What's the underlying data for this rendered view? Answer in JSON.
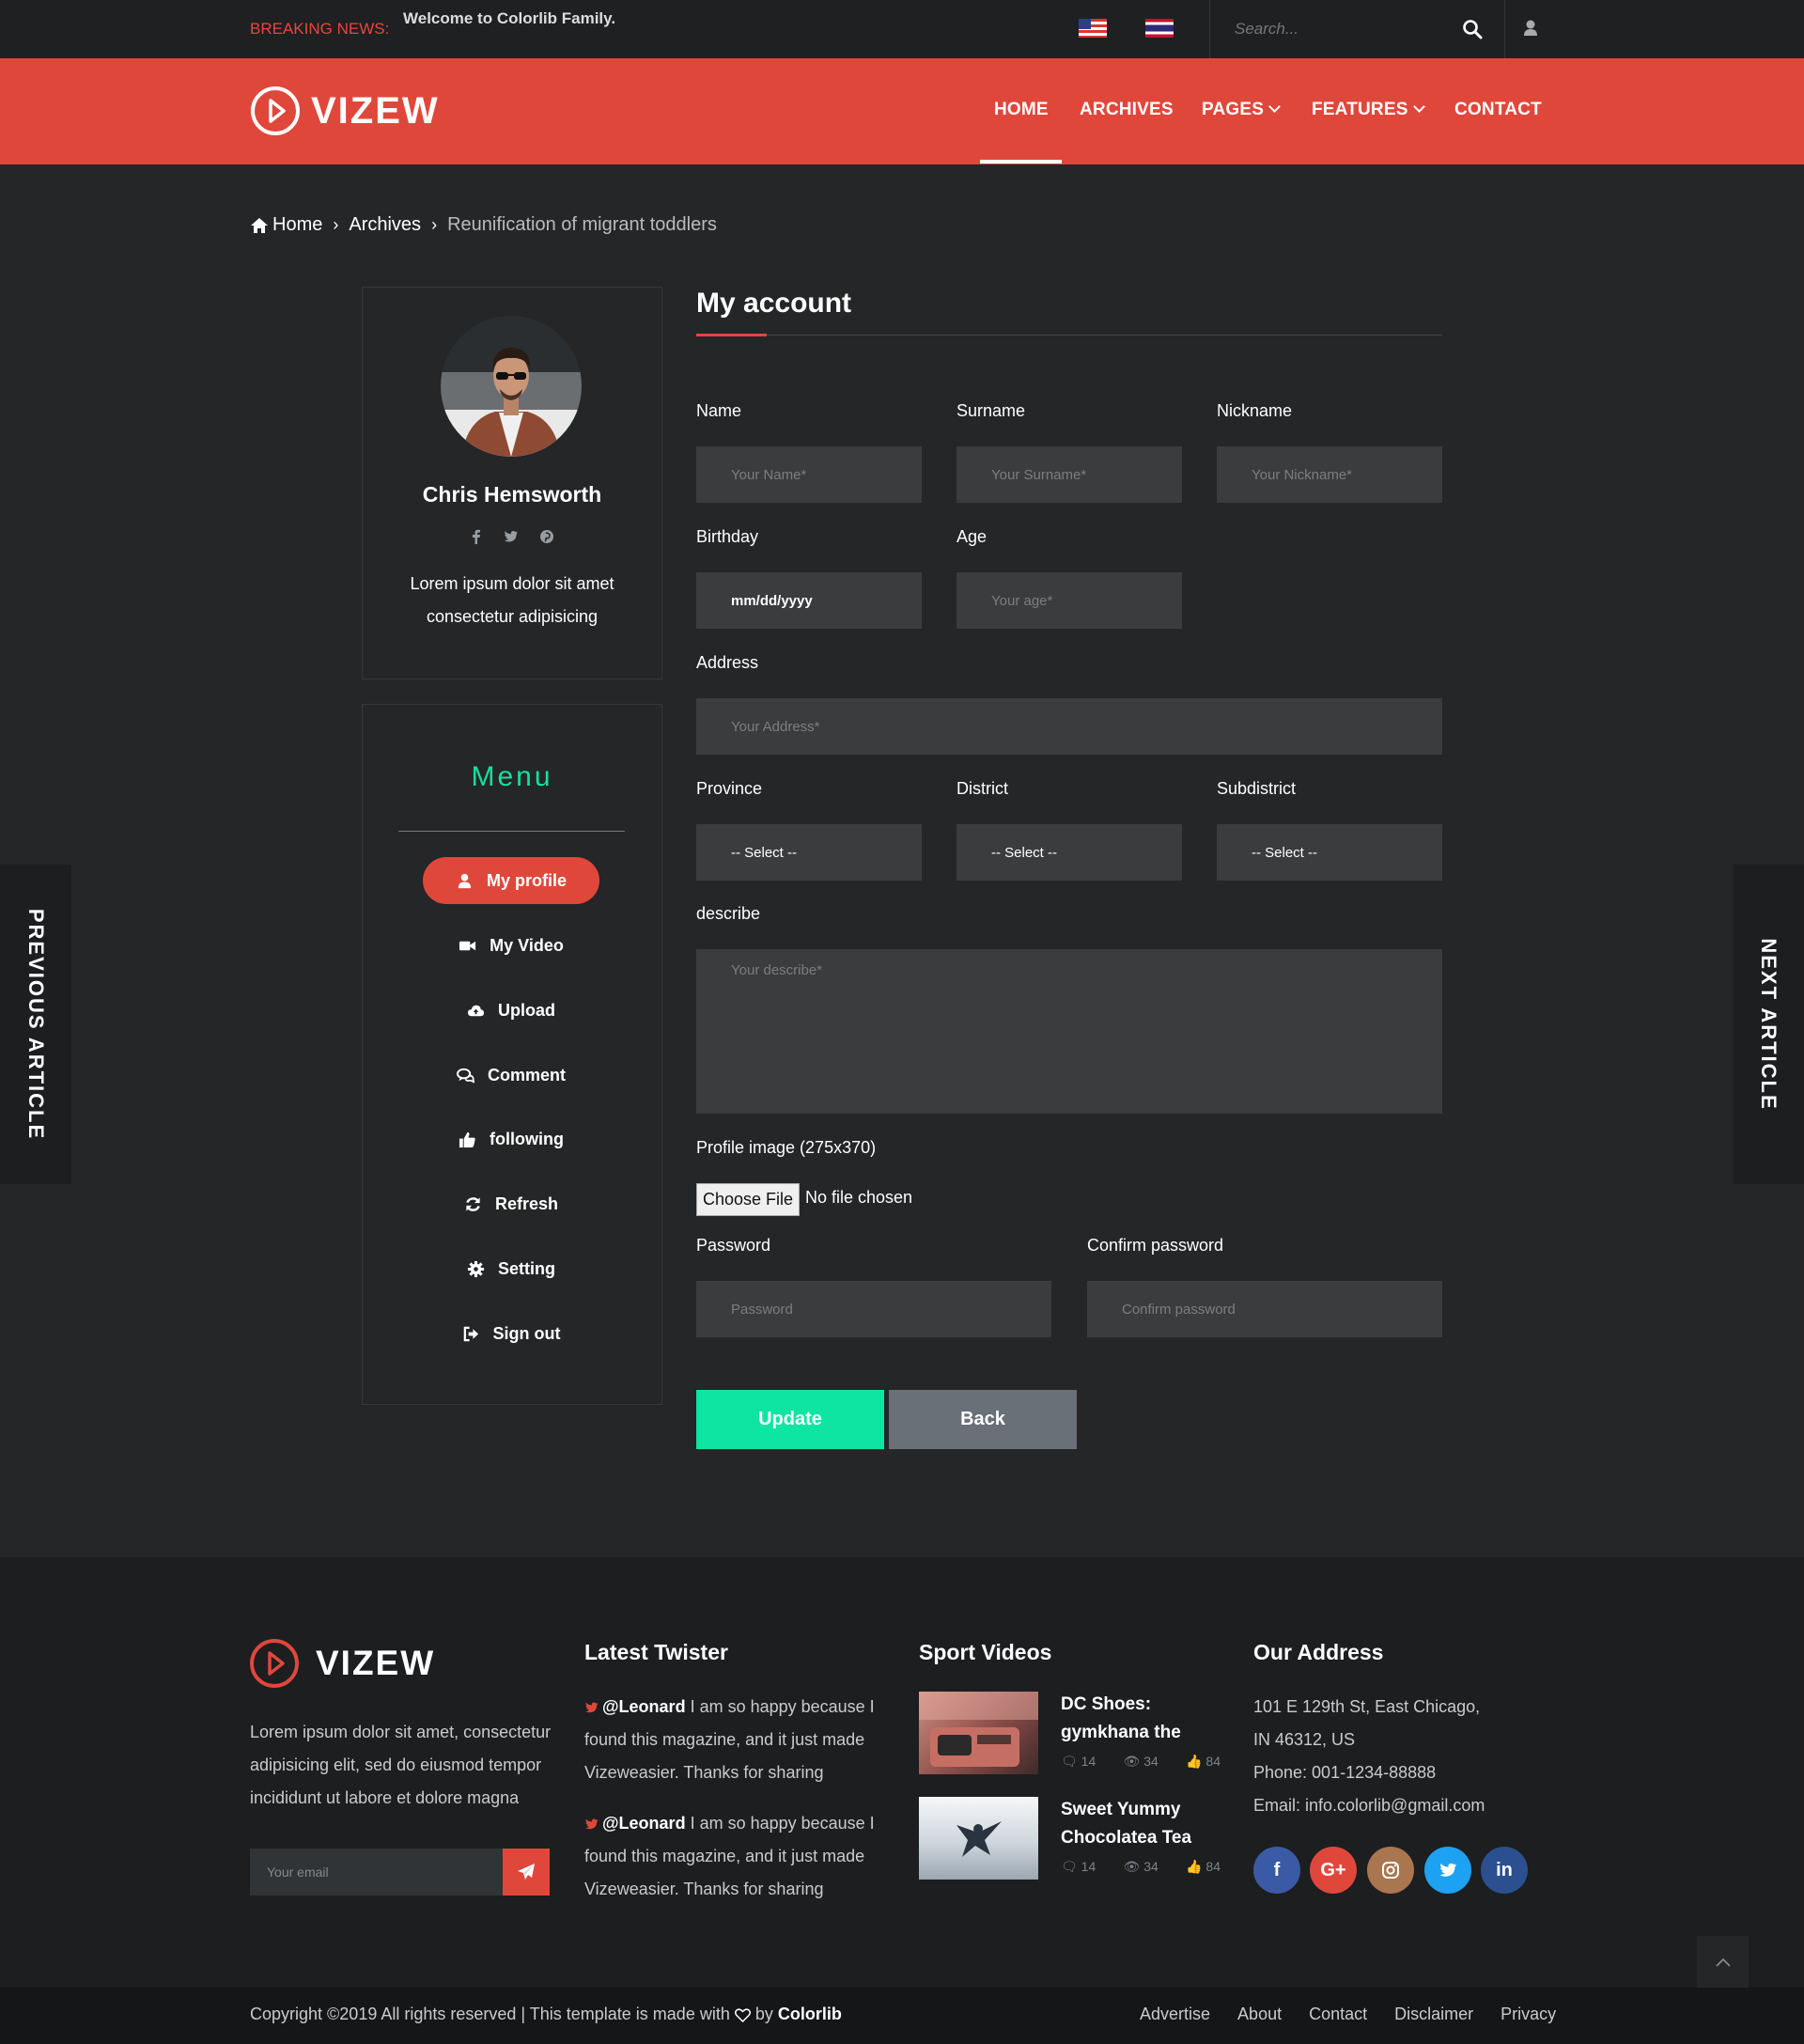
{
  "topbar": {
    "breaking_label": "BREAKING NEWS:",
    "breaking_text": "Welcome to Colorlib Family.",
    "search_placeholder": "Search..."
  },
  "header": {
    "logo_text": "VIZEW",
    "nav": [
      "HOME",
      "ARCHIVES",
      "PAGES",
      "FEATURES",
      "CONTACT"
    ],
    "active_nav": "HOME"
  },
  "breadcrumb": {
    "home": "Home",
    "archives": "Archives",
    "current": "Reunification of migrant toddlers"
  },
  "profile": {
    "name": "Chris Hemsworth",
    "bio_line1": "Lorem ipsum dolor sit amet",
    "bio_line2": "consectetur adipisicing",
    "social_icons": [
      "facebook-icon",
      "twitter-icon",
      "pinterest-icon"
    ]
  },
  "menu": {
    "title": "Menu",
    "items": [
      {
        "label": "My profile",
        "icon": "user-icon",
        "active": true
      },
      {
        "label": "My Video",
        "icon": "video-camera-icon"
      },
      {
        "label": "Upload",
        "icon": "cloud-upload-icon"
      },
      {
        "label": "Comment",
        "icon": "comments-icon"
      },
      {
        "label": "following",
        "icon": "thumbs-up-icon"
      },
      {
        "label": "Refresh",
        "icon": "refresh-icon"
      },
      {
        "label": "Setting",
        "icon": "gear-icon"
      },
      {
        "label": "Sign out",
        "icon": "sign-out-icon"
      }
    ]
  },
  "form": {
    "title": "My account",
    "name_label": "Name",
    "name_placeholder": "Your Name*",
    "surname_label": "Surname",
    "surname_placeholder": "Your Surname*",
    "nickname_label": "Nickname",
    "nickname_placeholder": "Your Nickname*",
    "birthday_label": "Birthday",
    "birthday_value": "mm/dd/yyyy",
    "age_label": "Age",
    "age_placeholder": "Your age*",
    "address_label": "Address",
    "address_placeholder": "Your Address*",
    "province_label": "Province",
    "province_value": "-- Select --",
    "district_label": "District",
    "district_value": "-- Select --",
    "subdistrict_label": "Subdistrict",
    "subdistrict_value": "-- Select --",
    "describe_label": "describe",
    "describe_placeholder": "Your describe*",
    "image_label": "Profile image (275x370)",
    "file_button": "Choose File",
    "file_status": "No file chosen",
    "password_label": "Password",
    "password_placeholder": "Password",
    "confirm_label": "Confirm password",
    "confirm_placeholder": "Confirm password",
    "update_button": "Update",
    "back_button": "Back"
  },
  "side_nav": {
    "previous": "PREVIOUS ARTICLE",
    "next": "NEXT ARTICLE"
  },
  "footer": {
    "logo_text": "VIZEW",
    "about": "Lorem ipsum dolor sit amet, consectetur adipisicing elit, sed do eiusmod tempor incididunt ut labore et dolore magna",
    "email_placeholder": "Your email",
    "twister_title": "Latest Twister",
    "tweets": [
      {
        "handle": "@Leonard",
        "text": " I am so happy because I found this magazine, and it just made Vizeweasier. Thanks for sharing"
      },
      {
        "handle": "@Leonard",
        "text": " I am so happy because I found this magazine, and it just made Vizeweasier. Thanks for sharing"
      }
    ],
    "videos_title": "Sport Videos",
    "videos": [
      {
        "title": "DC Shoes: gymkhana the",
        "comments": "14",
        "views": "34",
        "likes": "84"
      },
      {
        "title": "Sweet Yummy Chocolatea Tea",
        "comments": "14",
        "views": "34",
        "likes": "84"
      }
    ],
    "address_title": "Our Address",
    "address_line1": "101 E 129th St, East Chicago,",
    "address_line2": "IN 46312, US",
    "phone": "Phone: 001-1234-88888",
    "email": "Email: info.colorlib@gmail.com",
    "social": [
      "f",
      "G+",
      "ig",
      "tw",
      "in"
    ]
  },
  "copyright": {
    "text": "Copyright ©2019 All rights reserved | This template is made with",
    "by": " by ",
    "brand": "Colorlib",
    "links": [
      "Advertise",
      "About",
      "Contact",
      "Disclaimer",
      "Privacy"
    ]
  },
  "colors": {
    "accent": "#e0473b",
    "menu_title": "#14e09d",
    "update_button": "#0ee5a2",
    "back_button": "#6a7078",
    "page_bg": "#242627",
    "field_bg": "#3a3c3e"
  }
}
